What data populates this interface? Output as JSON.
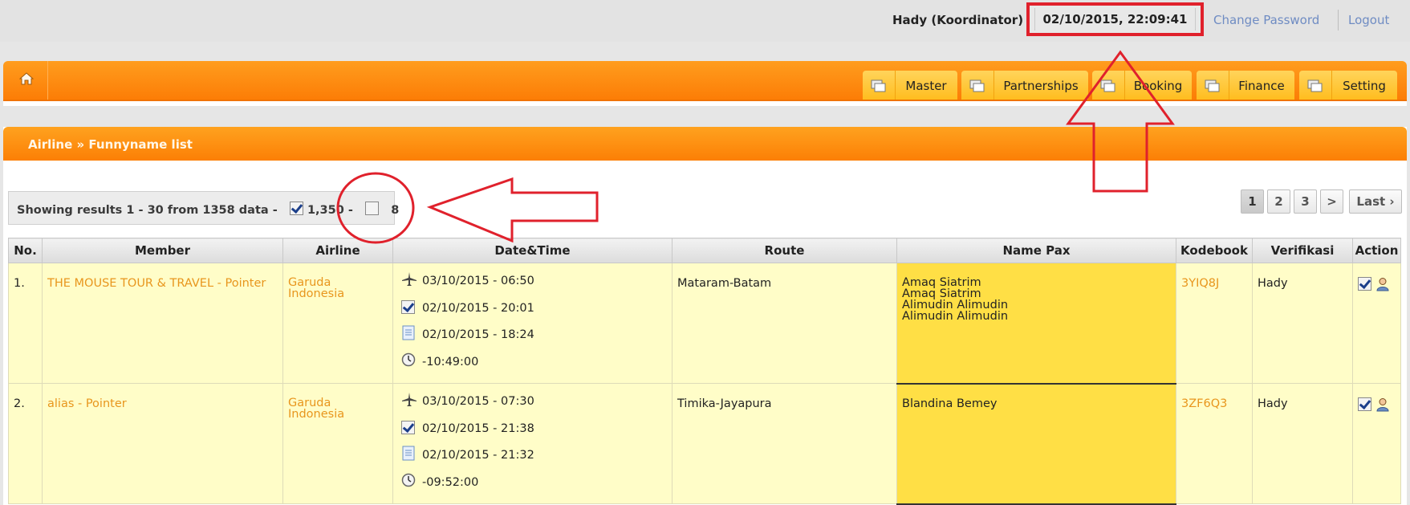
{
  "header": {
    "user": "Hady (Koordinator)",
    "datetime": "02/10/2015, 22:09:41",
    "change_password": "Change Password",
    "logout": "Logout"
  },
  "nav": {
    "home_icon": "home-icon",
    "tabs": [
      {
        "label": "Master",
        "icon": "window-icon"
      },
      {
        "label": "Partnerships",
        "icon": "window-icon"
      },
      {
        "label": "Booking",
        "icon": "window-icon"
      },
      {
        "label": "Finance",
        "icon": "window-icon"
      },
      {
        "label": "Setting",
        "icon": "window-icon"
      }
    ]
  },
  "breadcrumb": "Airline » Funnyname list",
  "results": {
    "text": "Showing results 1 - 30 from 1358 data -",
    "checked_count": "1,350",
    "sep": "-",
    "unchecked_count": "8"
  },
  "pagination": {
    "pages": [
      "1",
      "2",
      "3"
    ],
    "next": ">",
    "last": "Last ›",
    "active": "1"
  },
  "table": {
    "columns": [
      "No.",
      "Member",
      "Airline",
      "Date&Time",
      "Route",
      "Name Pax",
      "Kodebook",
      "Verifikasi",
      "Action"
    ],
    "rows": [
      {
        "no": "1.",
        "member": "THE MOUSE TOUR & TRAVEL - Pointer",
        "airline_line1": "Garuda",
        "airline_line2": "Indonesia",
        "flight": "03/10/2015 - 06:50",
        "verified": "02/10/2015 - 20:01",
        "booked": "02/10/2015 - 18:24",
        "time_left": "-10:49:00",
        "route": "Mataram-Batam",
        "pax": [
          "Amaq Siatrim",
          "Amaq Siatrim",
          "Alimudin Alimudin",
          "Alimudin Alimudin"
        ],
        "kodebook": "3YIQ8J",
        "verifikasi": "Hady"
      },
      {
        "no": "2.",
        "member": "alias - Pointer",
        "airline_line1": "Garuda",
        "airline_line2": "Indonesia",
        "flight": "03/10/2015 - 07:30",
        "verified": "02/10/2015 - 21:38",
        "booked": "02/10/2015 - 21:32",
        "time_left": "-09:52:00",
        "route": "Timika-Jayapura",
        "pax": [
          "Blandina Bemey"
        ],
        "kodebook": "3ZF6Q3",
        "verifikasi": "Hady"
      }
    ]
  },
  "colors": {
    "orange": "#fc7d06",
    "tab_yellow": "#ffc937",
    "row_bg": "#fffdc8",
    "pax_bg": "#ffdf45",
    "link": "#e8961d",
    "annotation_red": "#e0212c"
  }
}
